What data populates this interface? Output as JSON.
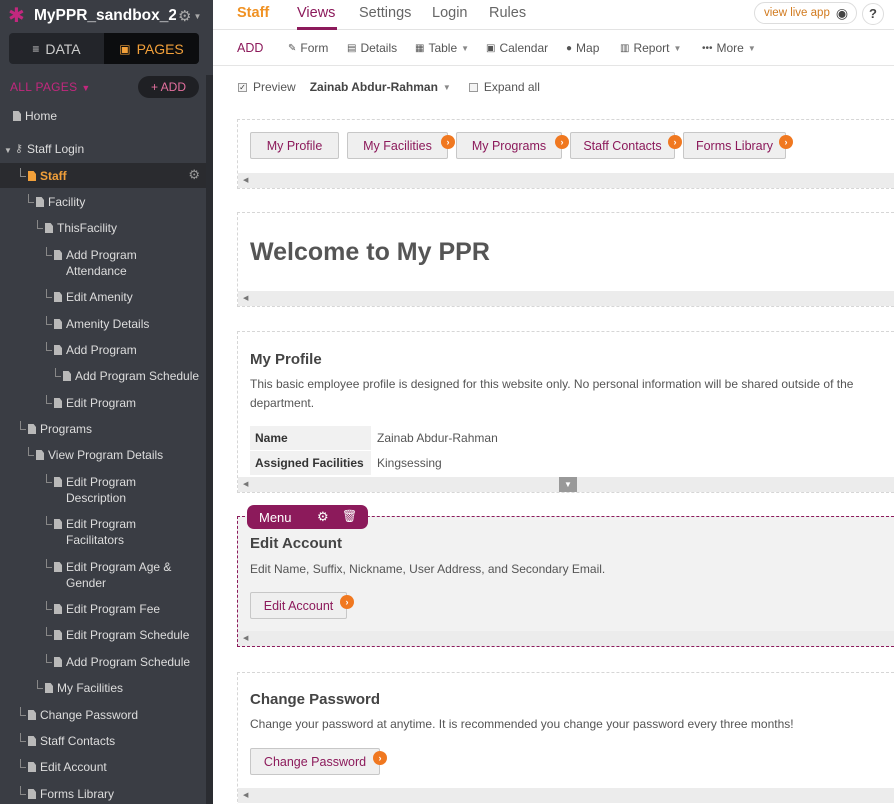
{
  "app": {
    "title": "MyPPR_sandbox_2..."
  },
  "sidebar": {
    "data_tab": "DATA",
    "pages_tab": "PAGES",
    "all_pages": "ALL PAGES",
    "add_label": "+ ADD",
    "pages": [
      {
        "label": "Home"
      },
      {
        "label": "Staff Login"
      },
      {
        "label": "Staff"
      },
      {
        "label": "Facility"
      },
      {
        "label": "ThisFacility"
      },
      {
        "label": "Add Program",
        "label2": "Attendance"
      },
      {
        "label": "Edit Amenity"
      },
      {
        "label": "Amenity Details"
      },
      {
        "label": "Add Program"
      },
      {
        "label": "Add Program Schedule"
      },
      {
        "label": "Edit Program"
      },
      {
        "label": "Programs"
      },
      {
        "label": "View Program Details"
      },
      {
        "label": "Edit Program",
        "label2": "Description"
      },
      {
        "label": "Edit Program",
        "label2": "Facilitators"
      },
      {
        "label": "Edit Program Age &",
        "label2": "Gender"
      },
      {
        "label": "Edit Program Fee"
      },
      {
        "label": "Edit Program Schedule"
      },
      {
        "label": "Add Program Schedule"
      },
      {
        "label": "My Facilities"
      },
      {
        "label": "Change Password"
      },
      {
        "label": "Staff Contacts"
      },
      {
        "label": "Edit Account"
      },
      {
        "label": "Forms Library"
      }
    ]
  },
  "topnav": {
    "staff": "Staff",
    "views": "Views",
    "settings": "Settings",
    "login": "Login",
    "rules": "Rules",
    "live": "view live app",
    "help": "?"
  },
  "toolbar": {
    "add": "ADD",
    "form": "Form",
    "details": "Details",
    "table": "Table",
    "calendar": "Calendar",
    "map": "Map",
    "report": "Report",
    "more": "More"
  },
  "preview": {
    "label": "Preview",
    "user": "Zainab Abdur-Rahman",
    "expand": "Expand all"
  },
  "menu_block": {
    "buttons": [
      "My Profile",
      "My Facilities",
      "My Programs",
      "Staff Contacts",
      "Forms Library"
    ]
  },
  "welcome": {
    "title": "Welcome to My PPR"
  },
  "profile": {
    "title": "My Profile",
    "desc": "This basic employee profile is designed for this website only. No personal information will be shared outside of the department.",
    "name_label": "Name",
    "name_value": "Zainab Abdur-Rahman",
    "fac_label": "Assigned Facilities",
    "fac_value": "Kingsessing"
  },
  "edit_account": {
    "menu_tag": "Menu",
    "title": "Edit Account",
    "desc": "Edit Name, Suffix, Nickname, User Address, and Secondary Email.",
    "button": "Edit Account"
  },
  "change_password": {
    "title": "Change Password",
    "desc": "Change your password at anytime. It is recommended you change your password every three months!",
    "button": "Change Password"
  },
  "colors": {
    "brand": "#8c1a5b",
    "accent": "#f09224",
    "sidebar": "#3a3d44"
  }
}
